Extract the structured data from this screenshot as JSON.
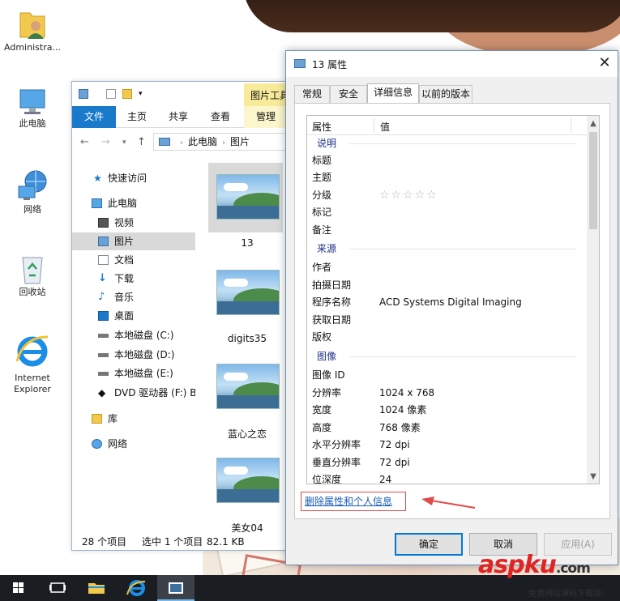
{
  "desktop": {
    "icons": [
      {
        "label": "Administra...",
        "icon": "user-folder-icon"
      },
      {
        "label": "此电脑",
        "icon": "computer-icon"
      },
      {
        "label": "网络",
        "icon": "network-icon"
      },
      {
        "label": "回收站",
        "icon": "recycle-bin-icon"
      },
      {
        "label": "Internet Explorer",
        "icon": "internet-explorer-icon"
      }
    ]
  },
  "explorer": {
    "contextual_tab": "图片工具",
    "ribbon_tabs": [
      "文件",
      "主页",
      "共享",
      "查看",
      "管理"
    ],
    "breadcrumb": [
      "此电脑",
      "图片"
    ],
    "nav": {
      "quick_access": "快速访问",
      "this_pc": "此电脑",
      "items": [
        "视频",
        "图片",
        "文档",
        "下载",
        "音乐",
        "桌面",
        "本地磁盘 (C:)",
        "本地磁盘 (D:)",
        "本地磁盘 (E:)",
        "DVD 驱动器 (F:) Bo"
      ],
      "library": "库",
      "network": "网络"
    },
    "files": [
      "13",
      "digits35",
      "蓝心之恋",
      "美女04"
    ],
    "status": {
      "count": "28 个项目",
      "selected": "选中 1 个项目",
      "size": "82.1 KB"
    }
  },
  "dialog": {
    "title": "13 属性",
    "tabs": [
      "常规",
      "安全",
      "详细信息",
      "以前的版本"
    ],
    "active_tab": "详细信息",
    "columns": {
      "property": "属性",
      "value": "值"
    },
    "groups": {
      "description": "说明",
      "origin": "来源",
      "image": "图像"
    },
    "rows": {
      "title": {
        "k": "标题",
        "v": ""
      },
      "subject": {
        "k": "主题",
        "v": ""
      },
      "rating": {
        "k": "分级",
        "stars": "☆☆☆☆☆",
        "value": 0
      },
      "tags": {
        "k": "标记",
        "v": ""
      },
      "comments": {
        "k": "备注",
        "v": ""
      },
      "authors": {
        "k": "作者",
        "v": ""
      },
      "date_taken": {
        "k": "拍摄日期",
        "v": ""
      },
      "program": {
        "k": "程序名称",
        "v": "ACD Systems Digital Imaging"
      },
      "date_acquired": {
        "k": "获取日期",
        "v": ""
      },
      "copyright": {
        "k": "版权",
        "v": ""
      },
      "image_id": {
        "k": "图像 ID",
        "v": ""
      },
      "dimensions": {
        "k": "分辨率",
        "v": "1024 x 768"
      },
      "width": {
        "k": "宽度",
        "v": "1024 像素"
      },
      "height": {
        "k": "高度",
        "v": "768 像素"
      },
      "hres": {
        "k": "水平分辨率",
        "v": "72 dpi"
      },
      "vres": {
        "k": "垂直分辨率",
        "v": "72 dpi"
      },
      "bitdepth": {
        "k": "位深度",
        "v": "24"
      }
    },
    "remove_link": "删除属性和个人信息",
    "buttons": {
      "ok": "确定",
      "cancel": "取消",
      "apply": "应用(A)"
    }
  },
  "watermark": {
    "brand": "aspku",
    "tld": ".com",
    "tagline": "免费网站源码下载站!"
  },
  "colors": {
    "accent": "#1979ca",
    "link": "#1a5db8",
    "highlight_red": "#e04b4b",
    "taskbar": "#1a1d22"
  }
}
